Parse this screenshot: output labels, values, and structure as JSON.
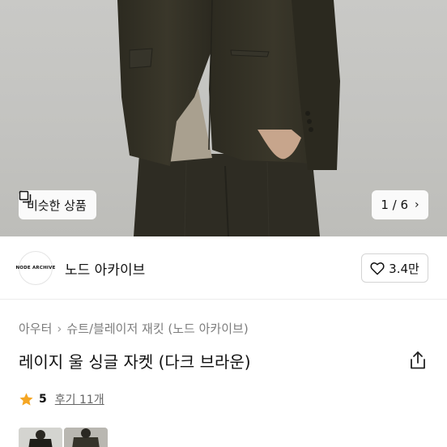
{
  "hero": {
    "similar_label": "비슷한 상품",
    "similar_icon": "similar-items-icon",
    "pager_text": "1 / 6",
    "pager_icon": "chevron-right-icon"
  },
  "shop": {
    "logo_text": "NODE ARCHIVE",
    "name": "노드 아카이브",
    "like_icon": "heart-icon",
    "like_count": "3.4만"
  },
  "breadcrumb": {
    "items": [
      "아우터",
      "슈트/블레이저 재킷 (노드 아카이브)"
    ],
    "separator": "›"
  },
  "product": {
    "title": "레이지 울 싱글 자켓 (다크 브라운)",
    "share_icon": "share-icon"
  },
  "rating": {
    "star_icon": "star-icon",
    "score": "5",
    "reviews": "후기 11개",
    "star_color": "#f5a623"
  }
}
